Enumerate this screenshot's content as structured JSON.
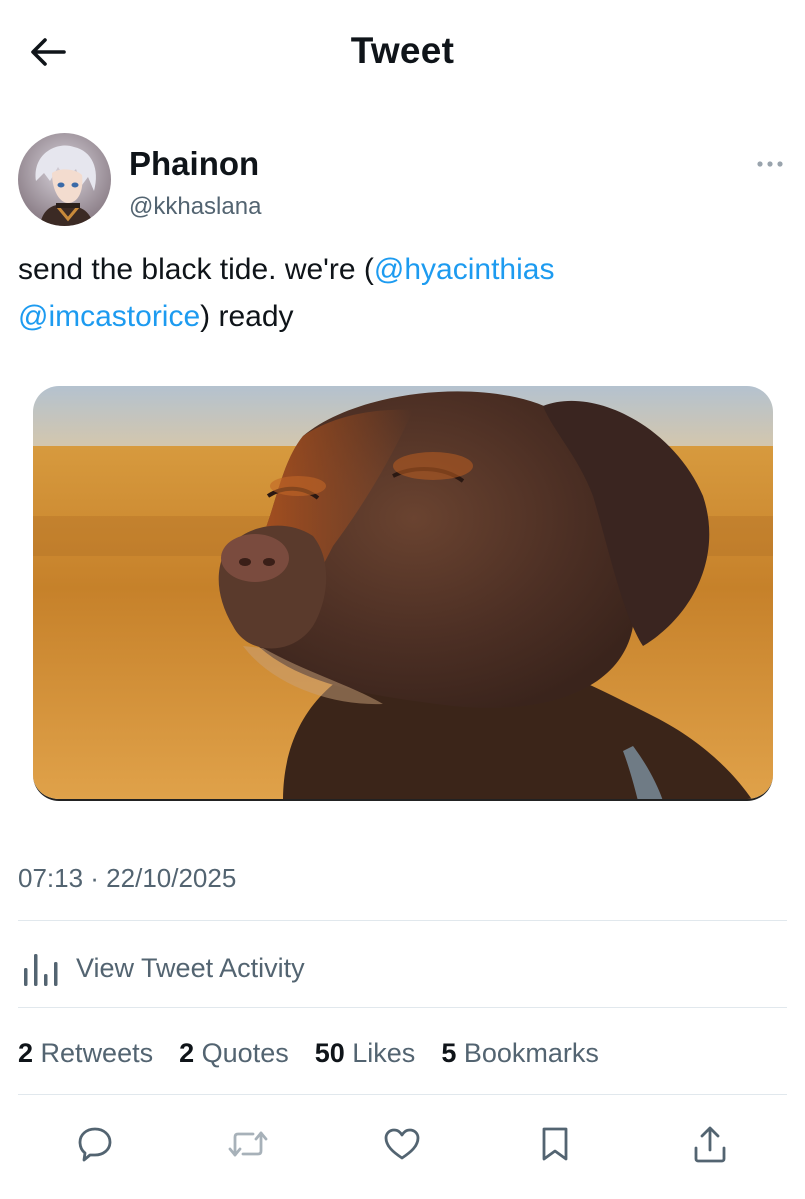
{
  "header": {
    "title": "Tweet",
    "back_icon": "arrow-left-icon"
  },
  "author": {
    "display_name": "Phainon",
    "handle": "@kkhaslana"
  },
  "tweet": {
    "text_1": "send the black tide. we're (",
    "mention_1": "@hyacinthias",
    "mention_2": "@imcastorice",
    "text_2": ") ready",
    "timestamp": "07:13 · 22/10/2025"
  },
  "activity": {
    "label": "View Tweet Activity",
    "icon": "bar-chart-icon"
  },
  "stats": [
    {
      "count": "2",
      "label": "Retweets"
    },
    {
      "count": "2",
      "label": "Quotes"
    },
    {
      "count": "50",
      "label": "Likes"
    },
    {
      "count": "5",
      "label": "Bookmarks"
    }
  ],
  "actions": [
    "reply-icon",
    "retweet-icon",
    "like-icon",
    "bookmark-icon",
    "share-icon"
  ],
  "colors": {
    "link": "#1d9bf0",
    "secondary_text": "#536471",
    "primary_text": "#0f1419",
    "divider": "#e1e8ed"
  }
}
